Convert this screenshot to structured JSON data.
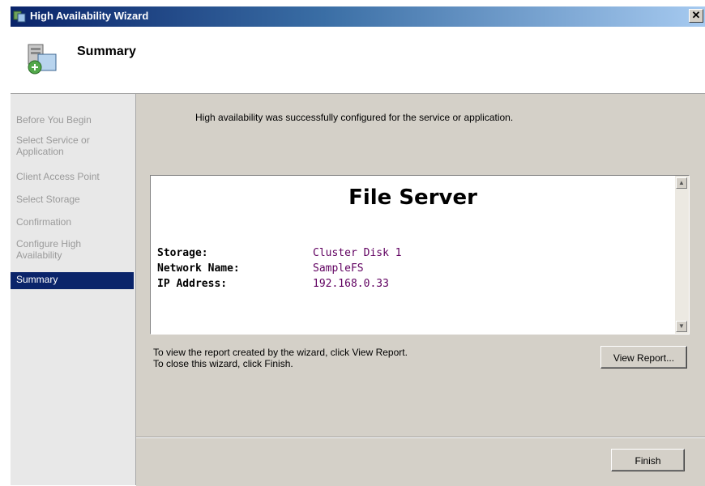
{
  "window": {
    "title": "High Availability Wizard",
    "close_glyph": "✕"
  },
  "header": {
    "title": "Summary"
  },
  "nav": {
    "items": [
      {
        "label": "Before You Begin"
      },
      {
        "label": "Select Service or Application"
      },
      {
        "label": "Client Access Point"
      },
      {
        "label": "Select Storage"
      },
      {
        "label": "Confirmation"
      },
      {
        "label": "Configure High Availability"
      },
      {
        "label": "Summary",
        "active": true
      }
    ]
  },
  "main": {
    "message": "High availability was successfully configured for the service or application.",
    "report": {
      "title": "File Server",
      "rows": [
        {
          "key": "Storage:",
          "value": "Cluster Disk 1"
        },
        {
          "key": "Network Name:",
          "value": "SampleFS"
        },
        {
          "key": "IP Address:",
          "value": "192.168.0.33"
        }
      ]
    },
    "hint_line1": "To view the report created by the wizard, click View Report.",
    "hint_line2": "To close this wizard, click Finish.",
    "view_report_label": "View Report..."
  },
  "footer": {
    "finish_label": "Finish"
  },
  "colors": {
    "titlebar": "#0a246a",
    "active_nav": "#0a246a",
    "report_value": "#600060",
    "dialog_bg": "#d4d0c8"
  }
}
